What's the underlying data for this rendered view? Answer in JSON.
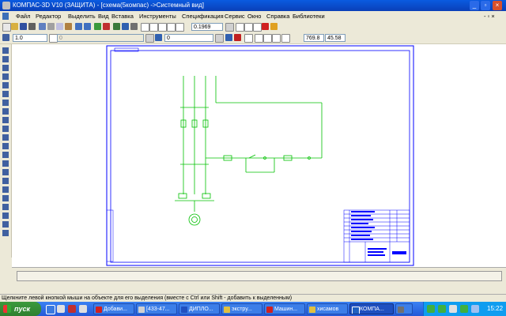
{
  "window": {
    "title": "КОМПАС-3D V10 (ЗАЩИТА) - [схема(5компас) ->Системный вид]",
    "minimize_label": "_",
    "restore_label": "▫",
    "close_label": "×"
  },
  "menu": {
    "items": [
      "Файл",
      "Редактор",
      "Выделить",
      "Вид",
      "Вставка",
      "Инструменты",
      "Спецификация",
      "Сервис",
      "Окно",
      "Справка",
      "Библиотеки"
    ],
    "doc_buttons": "- ▫ ×"
  },
  "toolbar": {
    "zoom_value": "0.1969",
    "scale_value": "1.0",
    "layer_value": "0",
    "style_value": "0",
    "coord_x": "769.8",
    "coord_y": "45.58"
  },
  "statusbar": {
    "hint": "Щелкните левой кнопкой мыши на объекте для его выделения (вместе с Ctrl или Shift - добавить к выделенным)"
  },
  "taskbar": {
    "start_label": "пуск",
    "tasks": [
      "Добави...",
      "[433-47...",
      "ДИПЛО...",
      "экстру...",
      "Машин...",
      "хисамов",
      "КОМПА..."
    ],
    "clock": "15:22"
  },
  "colors": {
    "titlebar": "#0a4fd0",
    "sheet_frame": "#0000ff",
    "circuit": "#00c000",
    "taskbar": "#2f6de0"
  }
}
